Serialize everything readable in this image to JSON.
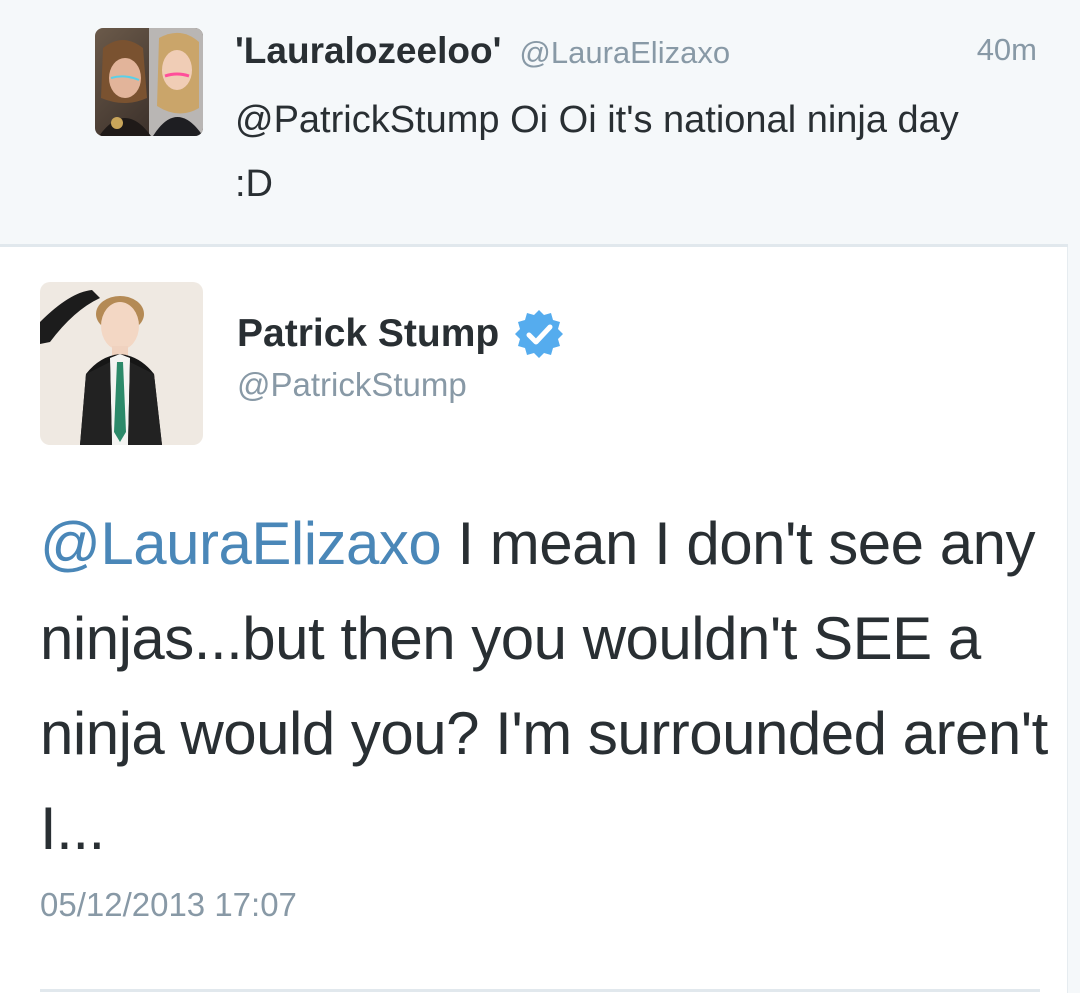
{
  "reply_tweet": {
    "display_name": "'Lauralozeeloo'",
    "handle": "@LauraElizaxo",
    "time": "40m",
    "text": "@PatrickStump Oi Oi it's national ninja day :D"
  },
  "main_tweet": {
    "display_name": "Patrick Stump",
    "handle": "@PatrickStump",
    "mention": "@LauraElizaxo",
    "text": " I mean I don't see any ninjas...but then you wouldn't SEE a ninja would you? I'm surrounded aren't I...",
    "timestamp": "05/12/2013 17:07",
    "verified": true
  },
  "colors": {
    "mention_blue": "#4a87b8",
    "verified_blue": "#55acee",
    "muted_gray": "#8899a6",
    "text_dark": "#292f33",
    "reply_background": "#f5f8fa"
  },
  "icons": {
    "verified": "verified-badge-icon"
  }
}
